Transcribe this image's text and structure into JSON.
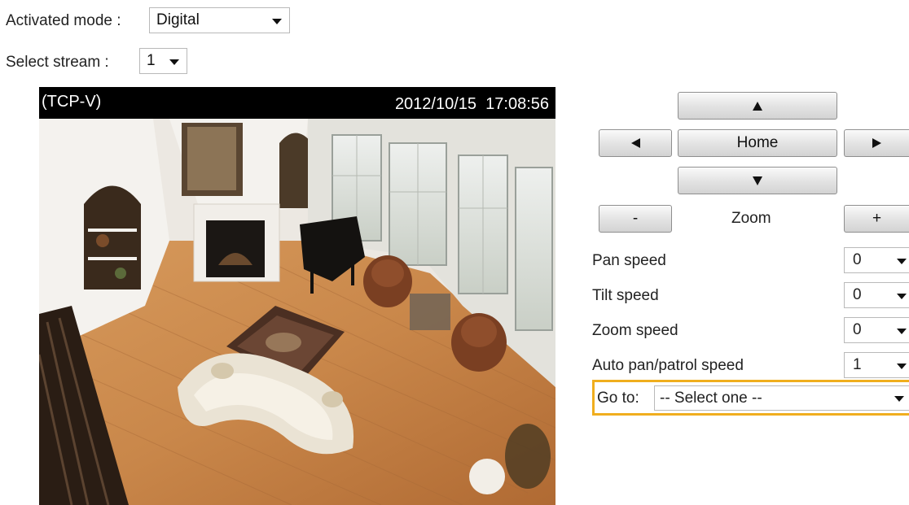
{
  "activated_mode": {
    "label": "Activated mode :",
    "value": "Digital"
  },
  "stream": {
    "label": "Select stream :",
    "value": "1"
  },
  "video": {
    "protocol": "(TCP-V)",
    "timestamp": "2012/10/15  17:08:56"
  },
  "ptz": {
    "home_label": "Home",
    "zoom_label": "Zoom",
    "zoom_out_label": "-",
    "zoom_in_label": "+"
  },
  "speeds": [
    {
      "label": "Pan speed",
      "value": "0"
    },
    {
      "label": "Tilt speed",
      "value": "0"
    },
    {
      "label": "Zoom speed",
      "value": "0"
    },
    {
      "label": "Auto pan/patrol speed",
      "value": "1"
    }
  ],
  "goto": {
    "label": "Go to:",
    "value": "-- Select one --"
  },
  "colors": {
    "highlight": "#f0ae1e",
    "floor": "#c8874a"
  },
  "icons": [
    "up-arrow-icon",
    "down-arrow-icon",
    "left-arrow-icon",
    "right-arrow-icon",
    "dropdown-arrow-icon"
  ]
}
